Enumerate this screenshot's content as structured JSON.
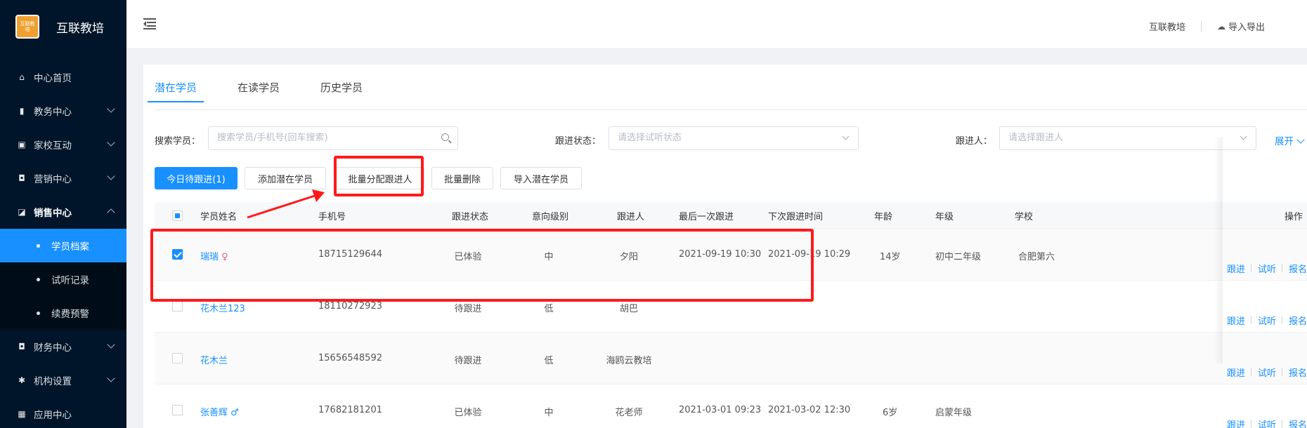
{
  "brand": {
    "name": "互联教培",
    "logo_text": "互联教培"
  },
  "sidebar": {
    "items": [
      {
        "label": "中心首页",
        "icon": "home-icon",
        "glyph": "⌂",
        "expandable": false
      },
      {
        "label": "教务中心",
        "icon": "book-icon",
        "glyph": "▮",
        "expandable": true
      },
      {
        "label": "家校互动",
        "icon": "chat-icon",
        "glyph": "▣",
        "expandable": true
      },
      {
        "label": "营销中心",
        "icon": "bag-icon",
        "glyph": "◘",
        "expandable": true
      },
      {
        "label": "销售中心",
        "icon": "chart-icon",
        "glyph": "◪",
        "expandable": true,
        "expanded": true
      }
    ],
    "sub_items": [
      {
        "label": "学员档案",
        "active": true
      },
      {
        "label": "试听记录",
        "active": false
      },
      {
        "label": "续费预警",
        "active": false
      }
    ],
    "items_after": [
      {
        "label": "财务中心",
        "icon": "wallet-icon",
        "glyph": "◘",
        "expandable": true
      },
      {
        "label": "机构设置",
        "icon": "gear-icon",
        "glyph": "✱",
        "expandable": true
      },
      {
        "label": "应用中心",
        "icon": "grid-icon",
        "glyph": "▦",
        "expandable": false
      }
    ]
  },
  "header": {
    "org_name": "互联教培",
    "import_export": "导入导出"
  },
  "tabs": [
    "潜在学员",
    "在读学员",
    "历史学员"
  ],
  "filters": {
    "search_label": "搜索学员：",
    "search_placeholder": "搜索学员/手机号(回车搜索)",
    "status_label": "跟进状态：",
    "status_placeholder": "请选择试听状态",
    "follower_label": "跟进人：",
    "follower_placeholder": "请选择跟进人",
    "expand": "展开"
  },
  "buttons": {
    "today": "今日待跟进(1)",
    "add": "添加潜在学员",
    "batch_assign": "批量分配跟进人",
    "batch_delete": "批量删除",
    "import": "导入潜在学员"
  },
  "table": {
    "columns": [
      "学员姓名",
      "手机号",
      "跟进状态",
      "意向级别",
      "跟进人",
      "最后一次跟进",
      "下次跟进时间",
      "年龄",
      "年级",
      "学校",
      "操作"
    ],
    "rows": [
      {
        "name": "瑞瑞",
        "gender": "♀",
        "phone": "18715129644",
        "status": "已体验",
        "level": "中",
        "follower": "夕阳",
        "last": "2021-09-19 10:30",
        "next": "2021-09-19 10:29",
        "age": "14岁",
        "grade": "初中二年级",
        "school": "合肥第六",
        "checked": true
      },
      {
        "name": "花木兰123",
        "gender": "",
        "phone": "18110272923",
        "status": "待跟进",
        "level": "低",
        "follower": "胡巴",
        "last": "",
        "next": "",
        "age": "",
        "grade": "",
        "school": "",
        "checked": false
      },
      {
        "name": "花木兰",
        "gender": "",
        "phone": "15656548592",
        "status": "待跟进",
        "level": "低",
        "follower": "海鸥云教培",
        "last": "",
        "next": "",
        "age": "",
        "grade": "",
        "school": "",
        "checked": false
      },
      {
        "name": "张善辉",
        "gender": "♂",
        "phone": "17682181201",
        "status": "已体验",
        "level": "中",
        "follower": "花老师",
        "last": "2021-03-01 09:23",
        "next": "2021-03-02 12:30",
        "age": "6岁",
        "grade": "启蒙年级",
        "school": "",
        "checked": false
      }
    ],
    "ops": [
      "跟进",
      "试听",
      "报名"
    ]
  },
  "colors": {
    "accent": "#1890ff",
    "sidebar": "#001529",
    "annotation": "#ff1a1a"
  }
}
